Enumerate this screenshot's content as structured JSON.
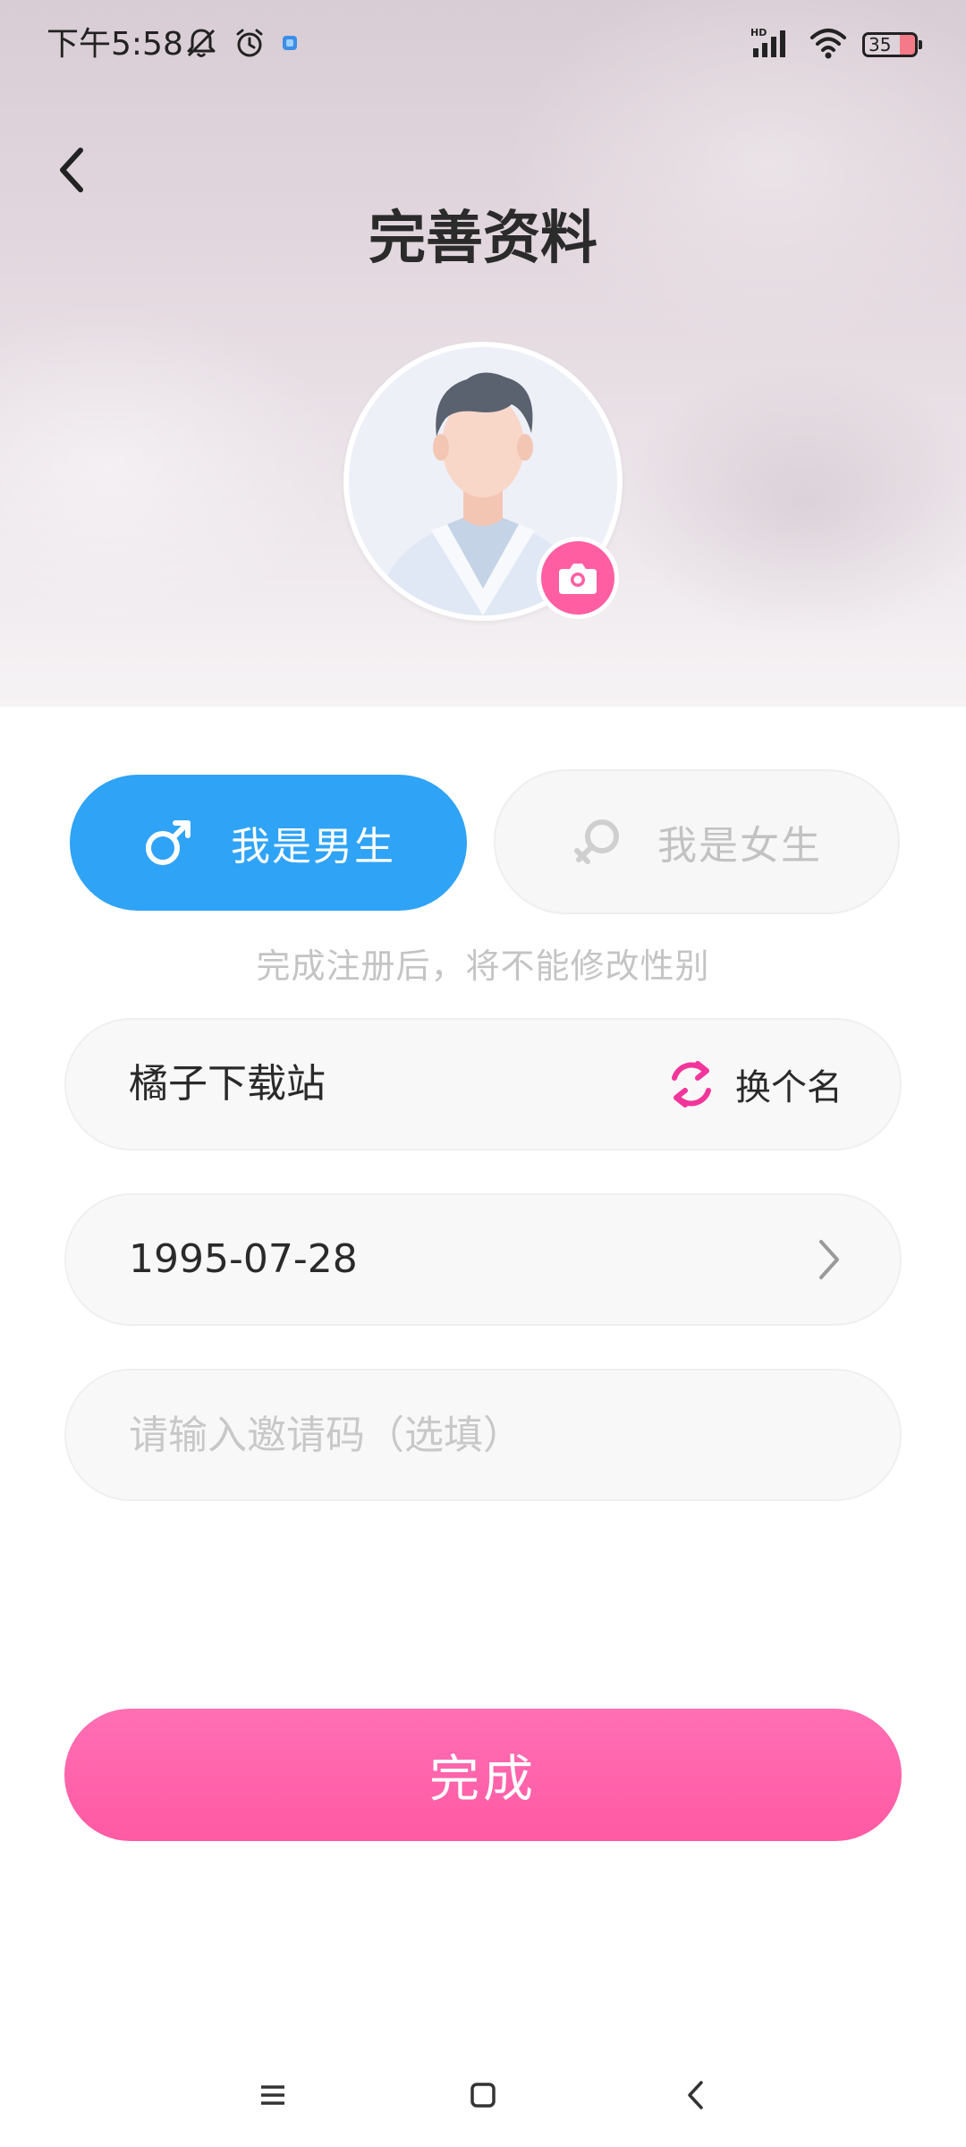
{
  "status_bar": {
    "time": "下午5:58",
    "battery_level": "35",
    "signal_label": "HD",
    "icons": [
      "mute-bell-icon",
      "alarm-icon",
      "app-notification-icon",
      "signal-icon",
      "wifi-icon",
      "battery-icon"
    ]
  },
  "header": {
    "back_icon": "chevron-left-icon",
    "title": "完善资料"
  },
  "avatar": {
    "camera_icon": "camera-icon"
  },
  "gender": {
    "male_label": "我是男生",
    "female_label": "我是女生",
    "selected": "male",
    "hint": "完成注册后，将不能修改性别"
  },
  "form": {
    "nickname": "橘子下载站",
    "rename_label": "换个名",
    "birthday": "1995-07-28",
    "invite_placeholder": "请输入邀请码（选填）"
  },
  "actions": {
    "done_label": "完成"
  },
  "colors": {
    "accent_blue": "#2fa3f6",
    "accent_pink": "#ff5fa2",
    "hint_gray": "#c4c4c4"
  },
  "nav_bar": {
    "icons": [
      "menu-icon",
      "home-icon",
      "back-icon"
    ]
  }
}
